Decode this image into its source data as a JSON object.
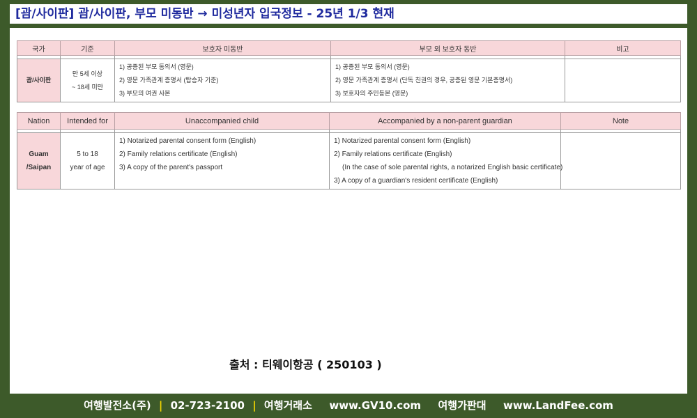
{
  "title": "[괌/사이판] 괌/사이판,  부모 미동반 → 미성년자 입국정보 - 25년 1/3 현재",
  "korean_table": {
    "headers": [
      "국가",
      "기준",
      "보호자 미동반",
      "부모 외 보호자 동반",
      "비고"
    ],
    "row": {
      "nation": "괌/사이판",
      "criteria": [
        "만 5세 이상",
        "~ 18세 미만"
      ],
      "unaccompanied": [
        "1) 공증된 부모 동의서 (영문)",
        "2) 영문 가족관계 증명서 (탑승자 기준)",
        "3) 부모의 여권 사본"
      ],
      "accompanied": [
        "1) 공증된 부모 동의서 (영문)",
        "2) 영문 가족관계 증명서 (단독 친권의 경우, 공증된 영문 기본증명서)",
        "3) 보호자의 주민등본 (영문)"
      ],
      "note": ""
    }
  },
  "english_table": {
    "headers": [
      "Nation",
      "Intended for",
      "Unaccompanied child",
      "Accompanied by a non-parent guardian",
      "Note"
    ],
    "row": {
      "nation": [
        "Guam",
        "/Saipan"
      ],
      "criteria": [
        "5 to 18",
        "year of age"
      ],
      "unaccompanied": [
        "1) Notarized parental consent form (English)",
        "2) Family relations certificate (English)",
        "3) A copy of the parent's passport"
      ],
      "accompanied": [
        "1) Notarized parental consent form (English)",
        "2) Family relations certificate (English)",
        "(In the case of sole parental rights, a notarized English basic certificate)",
        "3) A copy of a guardian's resident certificate (English)"
      ],
      "note": ""
    }
  },
  "source": "출처 : 티웨이항공 ( 250103 )",
  "footer": {
    "company": "여행발전소(주)",
    "phone": "02-723-2100",
    "site1_name": "여행거래소",
    "site1_url": "www.GV10.com",
    "site2_name": "여행가판대",
    "site2_url": "www.LandFee.com",
    "separator": "|"
  },
  "colors": {
    "background": "#3d5a2a",
    "title_text": "#1f2a9e",
    "header_fill": "#f8d7da",
    "footer_separator": "#f2d400"
  }
}
